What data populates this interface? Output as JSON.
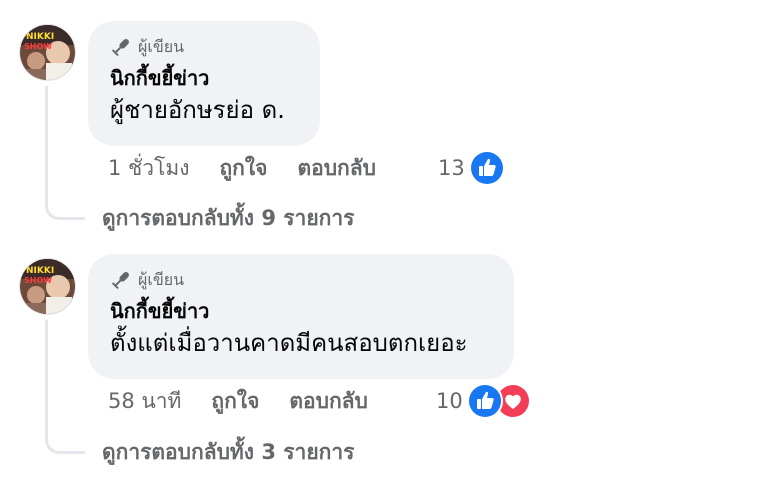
{
  "comments": [
    {
      "badge": "ผู้เขียน",
      "author": "นิกกี้ขยี้ข่าว",
      "text": "ผู้ชายอักษรย่อ ด.",
      "time": "1 ชั่วโมง",
      "like_label": "ถูกใจ",
      "reply_label": "ตอบกลับ",
      "reaction_count": "13",
      "reactions": [
        "like"
      ],
      "view_replies": "ดูการตอบกลับทั้ง 9 รายการ"
    },
    {
      "badge": "ผู้เขียน",
      "author": "นิกกี้ขยี้ข่าว",
      "text": "ตั้งแต่เมื่อวานคาดมีคนสอบตกเยอะ",
      "time": "58 นาที",
      "like_label": "ถูกใจ",
      "reply_label": "ตอบกลับ",
      "reaction_count": "10",
      "reactions": [
        "like",
        "love"
      ],
      "view_replies": "ดูการตอบกลับทั้ง 3 รายการ"
    }
  ],
  "colors": {
    "bubble": "#f0f2f5",
    "secondary_text": "#65676b",
    "like_blue": "#1877f2",
    "love_red": "#f33e58",
    "thread_line": "#e4e6eb"
  }
}
